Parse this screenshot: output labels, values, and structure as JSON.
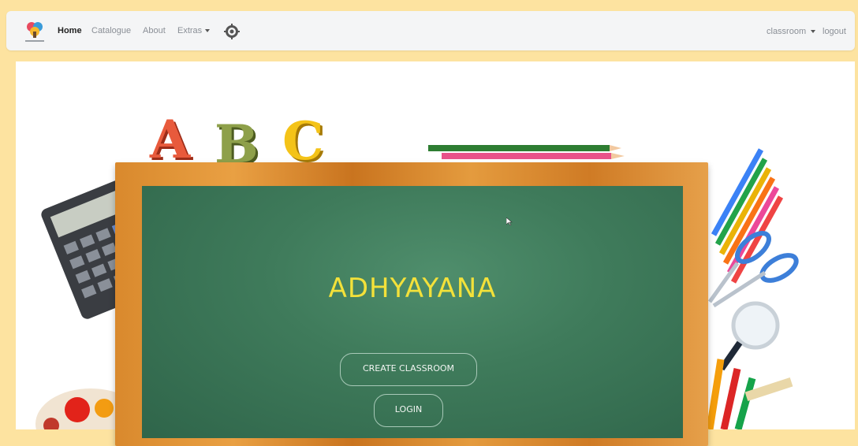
{
  "navbar": {
    "links": [
      {
        "label": "Home"
      },
      {
        "label": "Catalogue"
      },
      {
        "label": "About"
      },
      {
        "label": "Extras"
      }
    ],
    "classroom_label": "classroom",
    "logout_label": "logout"
  },
  "hero": {
    "title": "ADHYAYANA",
    "abc": [
      "A",
      "B",
      "C"
    ],
    "create_label": "CREATE CLASSROOM",
    "login_label": "LOGIN"
  },
  "colors": {
    "page_background": "#fde3a0",
    "board": "#3f7b5b",
    "title": "#f3e13a"
  }
}
